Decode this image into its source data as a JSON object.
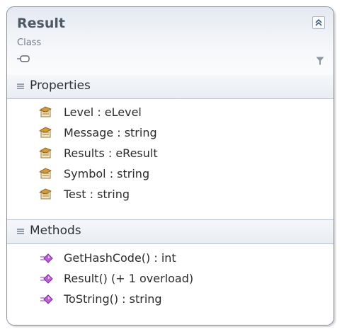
{
  "class": {
    "name": "Result",
    "stereotype": "Class"
  },
  "sections": {
    "properties": {
      "label": "Properties",
      "items": [
        {
          "text": "Level : eLevel",
          "icon": "property-icon"
        },
        {
          "text": "Message : string",
          "icon": "property-icon"
        },
        {
          "text": "Results : eResult",
          "icon": "property-icon"
        },
        {
          "text": "Symbol : string",
          "icon": "property-icon"
        },
        {
          "text": "Test : string",
          "icon": "property-icon"
        }
      ]
    },
    "methods": {
      "label": "Methods",
      "items": [
        {
          "text": "GetHashCode() : int",
          "icon": "method-icon"
        },
        {
          "text": "Result() (+ 1 overload)",
          "icon": "method-icon"
        },
        {
          "text": "ToString() : string",
          "icon": "method-icon"
        }
      ]
    }
  },
  "colors": {
    "border": "#7f8fa6",
    "method_icon": "#c060d8",
    "property_icon": "#d29a3a"
  }
}
